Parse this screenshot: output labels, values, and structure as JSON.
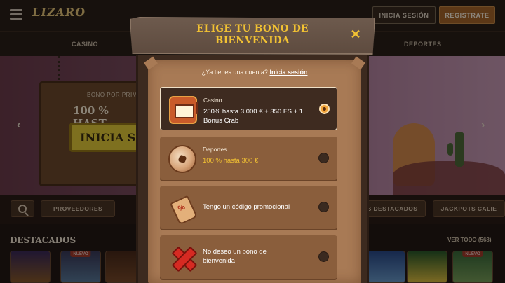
{
  "header": {
    "logo_text": "LIZARO",
    "login_label": "INICIA SESIÓN",
    "register_label": "REGISTRATE"
  },
  "nav": {
    "items": [
      "CASINO",
      "DEPORTES"
    ]
  },
  "hero": {
    "small_text": "BONO POR PRIM",
    "big_text": "100 % HAST",
    "cta_label": "INICIA S"
  },
  "categories": {
    "providers_label": "PROVEEDORES",
    "featured_label": "OS DESTACADOS",
    "jackpots_label": "JACKPOTS CALIE"
  },
  "featured": {
    "title": "DESTACADOS",
    "see_all": "VER TODO (568)",
    "new_badge": "NUEVO"
  },
  "modal": {
    "title": "ELIGE TU BONO DE BIENVENIDA",
    "account_prompt": "¿Ya tienes una cuenta?",
    "account_link": "Inicia sesión",
    "options": [
      {
        "label": "Casino",
        "text": "250% hasta 3.000 € + 350 FS + 1 Bonus Crab",
        "icon": "slot-machine-icon",
        "selected": true
      },
      {
        "label": "Deportes",
        "text": "100 % hasta 300 €",
        "icon": "football-icon",
        "selected": false
      },
      {
        "label": "",
        "text": "Tengo un código promocional",
        "icon": "promo-tag-icon",
        "selected": false
      },
      {
        "label": "",
        "text": "No deseo un bono de bienvenida",
        "icon": "red-x-icon",
        "selected": false
      }
    ]
  },
  "colors": {
    "accent_gold": "#f2c233",
    "selected_radio": "#f2a53c",
    "parchment": "#a87a55",
    "register_orange": "#a8662a"
  }
}
